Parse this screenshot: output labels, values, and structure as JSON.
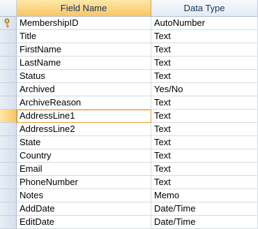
{
  "header": {
    "field_name": "Field Name",
    "data_type": "Data Type"
  },
  "key_icon": "primary-key-icon",
  "rows": [
    {
      "field": "MembershipID",
      "type": "AutoNumber"
    },
    {
      "field": "Title",
      "type": "Text"
    },
    {
      "field": "FirstName",
      "type": "Text"
    },
    {
      "field": "LastName",
      "type": "Text"
    },
    {
      "field": "Status",
      "type": "Text"
    },
    {
      "field": "Archived",
      "type": "Yes/No"
    },
    {
      "field": "ArchiveReason",
      "type": "Text"
    },
    {
      "field": "AddressLine1",
      "type": "Text"
    },
    {
      "field": "AddressLine2",
      "type": "Text"
    },
    {
      "field": "State",
      "type": "Text"
    },
    {
      "field": "Country",
      "type": "Text"
    },
    {
      "field": "Email",
      "type": "Text"
    },
    {
      "field": "PhoneNumber",
      "type": "Text"
    },
    {
      "field": "Notes",
      "type": "Memo"
    },
    {
      "field": "AddDate",
      "type": "Date/Time"
    },
    {
      "field": "EditDate",
      "type": "Date/Time"
    }
  ]
}
